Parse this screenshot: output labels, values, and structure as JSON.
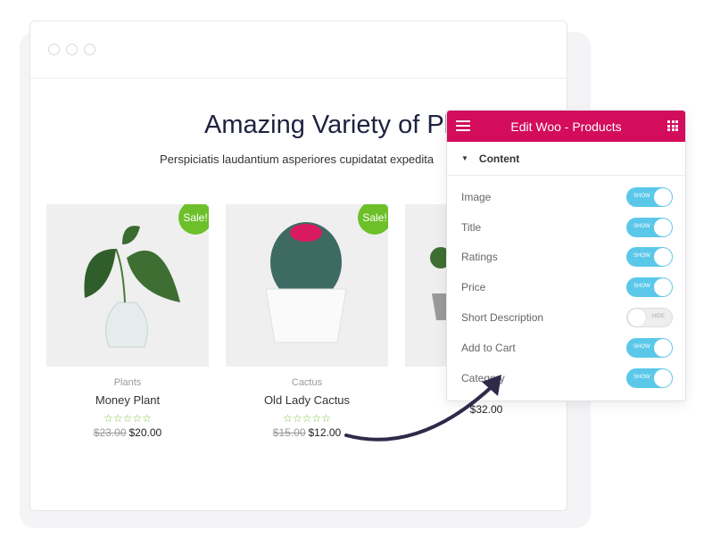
{
  "page": {
    "heading": "Amazing Variety of Plants",
    "subheading": "Perspiciatis laudantium asperiores cupidatat expedita"
  },
  "products": [
    {
      "category": "Plants",
      "name": "Money Plant",
      "old_price": "$23.00",
      "price": "$20.00",
      "badge": "Sale!",
      "rating": 0
    },
    {
      "category": "Cactus",
      "name": "Old Lady Cactus",
      "old_price": "$15.00",
      "price": "$12.00",
      "badge": "Sale!",
      "rating": 0
    },
    {
      "category": "",
      "name": "",
      "old_price": "",
      "price": "$32.00",
      "badge": "",
      "rating": 0
    }
  ],
  "stars": "☆☆☆☆☆",
  "panel": {
    "title": "Edit Woo - Products",
    "section": "Content",
    "accent": "#d30c5c",
    "toggle_color": "#5bc8ea",
    "rows": [
      {
        "label": "Image",
        "state": "SHOW"
      },
      {
        "label": "Title",
        "state": "SHOW"
      },
      {
        "label": "Ratings",
        "state": "SHOW"
      },
      {
        "label": "Price",
        "state": "SHOW"
      },
      {
        "label": "Short Description",
        "state": "HIDE"
      },
      {
        "label": "Add to Cart",
        "state": "SHOW"
      },
      {
        "label": "Category",
        "state": "SHOW"
      }
    ]
  }
}
